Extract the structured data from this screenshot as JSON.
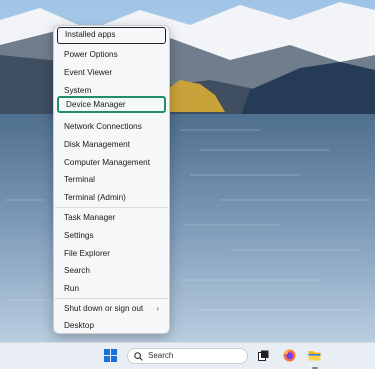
{
  "menu": {
    "items": [
      {
        "label": "Installed apps",
        "top": 1
      },
      {
        "label": "Power Options"
      },
      {
        "label": "Event Viewer"
      },
      {
        "label": "System"
      },
      {
        "label": "Device Manager"
      },
      {
        "label": "Network Connections"
      },
      {
        "label": "Disk Management"
      },
      {
        "label": "Computer Management"
      },
      {
        "label": "Terminal"
      },
      {
        "label": "Terminal (Admin)"
      },
      {
        "label": "Task Manager"
      },
      {
        "label": "Settings"
      },
      {
        "label": "File Explorer"
      },
      {
        "label": "Search"
      },
      {
        "label": "Run"
      },
      {
        "label": "Shut down or sign out",
        "has_submenu": true
      },
      {
        "label": "Desktop"
      }
    ],
    "selected_item": "Installed apps",
    "highlighted_item": "Device Manager"
  },
  "taskbar": {
    "search_placeholder": "Search",
    "icons": [
      "windows-start-icon",
      "search-icon",
      "task-view-icon",
      "firefox-icon",
      "file-explorer-icon"
    ]
  },
  "colors": {
    "highlight_border": "#1f8f66",
    "menu_bg": "#f6f7f9",
    "start_blue": "#1a73d9"
  }
}
